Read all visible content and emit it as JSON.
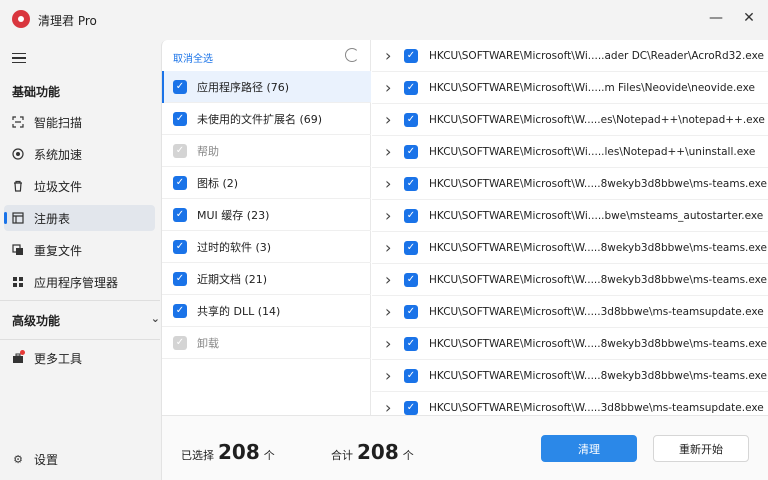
{
  "app": {
    "title": "清理君 Pro"
  },
  "window": {
    "minimize_icon": "minimize-icon",
    "close_icon": "close-icon"
  },
  "sidebar": {
    "menu_icon": "hamburger-icon",
    "basic_section": "基础功能",
    "items": [
      {
        "label": "智能扫描",
        "icon": "scan-icon"
      },
      {
        "label": "系统加速",
        "icon": "speed-icon"
      },
      {
        "label": "垃圾文件",
        "icon": "trash-icon"
      },
      {
        "label": "注册表",
        "icon": "registry-icon",
        "active": true
      },
      {
        "label": "重复文件",
        "icon": "duplicate-icon"
      },
      {
        "label": "应用程序管理器",
        "icon": "apps-icon"
      }
    ],
    "advanced_section": "高级功能",
    "more_tools": "更多工具",
    "settings": "设置"
  },
  "categories": {
    "deselect_all": "取消全选",
    "items": [
      {
        "label": "应用程序路径 (76)",
        "checked": true,
        "selected": true
      },
      {
        "label": "未使用的文件扩展名 (69)",
        "checked": true
      },
      {
        "label": "帮助",
        "checked": true,
        "disabled": true
      },
      {
        "label": "图标 (2)",
        "checked": true
      },
      {
        "label": "MUI 缓存 (23)",
        "checked": true
      },
      {
        "label": "过时的软件 (3)",
        "checked": true
      },
      {
        "label": "近期文档 (21)",
        "checked": true
      },
      {
        "label": "共享的 DLL (14)",
        "checked": true
      },
      {
        "label": "卸载",
        "checked": true,
        "disabled": true
      }
    ]
  },
  "entries": [
    "HKCU\\SOFTWARE\\Microsoft\\Wi.....ader DC\\Reader\\AcroRd32.exe",
    "HKCU\\SOFTWARE\\Microsoft\\Wi.....m Files\\Neovide\\neovide.exe",
    "HKCU\\SOFTWARE\\Microsoft\\W.....es\\Notepad++\\notepad++.exe",
    "HKCU\\SOFTWARE\\Microsoft\\Wi.....les\\Notepad++\\uninstall.exe",
    "HKCU\\SOFTWARE\\Microsoft\\W.....8wekyb3d8bbwe\\ms-teams.exe",
    "HKCU\\SOFTWARE\\Microsoft\\Wi.....bwe\\msteams_autostarter.exe",
    "HKCU\\SOFTWARE\\Microsoft\\W.....8wekyb3d8bbwe\\ms-teams.exe",
    "HKCU\\SOFTWARE\\Microsoft\\W.....8wekyb3d8bbwe\\ms-teams.exe",
    "HKCU\\SOFTWARE\\Microsoft\\W.....3d8bbwe\\ms-teamsupdate.exe",
    "HKCU\\SOFTWARE\\Microsoft\\W.....8wekyb3d8bbwe\\ms-teams.exe",
    "HKCU\\SOFTWARE\\Microsoft\\W.....8wekyb3d8bbwe\\ms-teams.exe",
    "HKCU\\SOFTWARE\\Microsoft\\W.....3d8bbwe\\ms-teamsupdate.exe"
  ],
  "footer": {
    "selected_label": "已选择",
    "selected_count": "208",
    "selected_unit": "个",
    "total_label": "合计",
    "total_count": "208",
    "total_unit": "个",
    "clean_button": "清理",
    "restart_button": "重新开始"
  },
  "colors": {
    "accent": "#1a73e8",
    "primary_button": "#2b88e8",
    "logo": "#d9363e",
    "notification_dot": "#e53935"
  }
}
